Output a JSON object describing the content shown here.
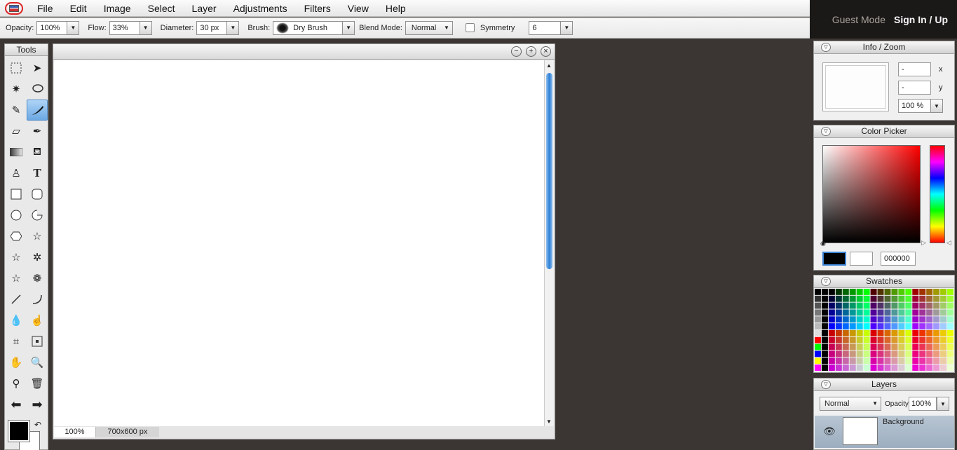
{
  "menubar": {
    "items": [
      "File",
      "Edit",
      "Image",
      "Select",
      "Layer",
      "Adjustments",
      "Filters",
      "View",
      "Help"
    ]
  },
  "account": {
    "mode": "Guest Mode",
    "signin": "Sign In / Up"
  },
  "options": {
    "opacity_label": "Opacity:",
    "opacity_value": "100%",
    "flow_label": "Flow:",
    "flow_value": "33%",
    "diameter_label": "Diameter:",
    "diameter_value": "30 px",
    "brush_label": "Brush:",
    "brush_value": "Dry Brush",
    "blend_label": "Blend Mode:",
    "blend_value": "Normal",
    "symmetry_label": "Symmetry",
    "symmetry_value": "6"
  },
  "tools": {
    "title": "Tools"
  },
  "canvas": {
    "zoom": "100%",
    "size": "700x600 px"
  },
  "info": {
    "title": "Info / Zoom",
    "x_value": "-",
    "y_value": "-",
    "x_label": "x",
    "y_label": "y",
    "zoom": "100 %"
  },
  "picker": {
    "title": "Color Picker",
    "hex": "000000",
    "fg_color": "#000000",
    "bg_color": "#ffffff"
  },
  "swatches": {
    "title": "Swatches"
  },
  "layers": {
    "title": "Layers",
    "mode": "Normal",
    "opacity_label": "Opacity:",
    "opacity_value": "100%",
    "layer_name": "Background"
  }
}
